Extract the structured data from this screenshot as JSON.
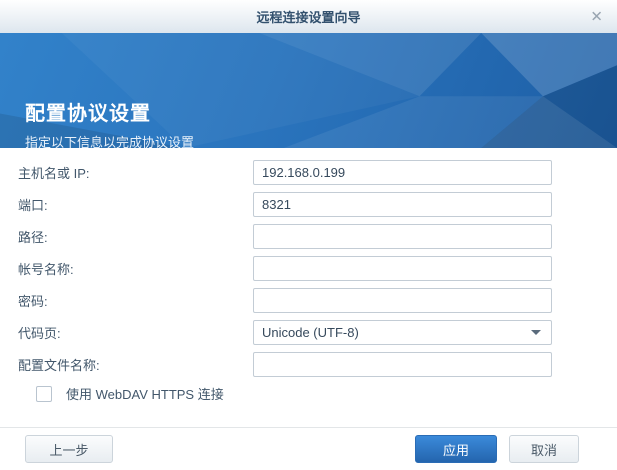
{
  "dialog": {
    "title": "远程连接设置向导"
  },
  "banner": {
    "title": "配置协议设置",
    "subtitle": "指定以下信息以完成协议设置"
  },
  "form": {
    "fields": [
      {
        "label": "主机名或 IP:",
        "value": "192.168.0.199",
        "type": "text"
      },
      {
        "label": "端口:",
        "value": "8321",
        "type": "text"
      },
      {
        "label": "路径:",
        "value": "",
        "type": "text"
      },
      {
        "label": "帐号名称:",
        "value": "",
        "type": "text"
      },
      {
        "label": "密码:",
        "value": "",
        "type": "password"
      },
      {
        "label": "代码页:",
        "value": "Unicode (UTF-8)",
        "type": "select"
      },
      {
        "label": "配置文件名称:",
        "value": "",
        "type": "text"
      }
    ],
    "checkbox": {
      "label": "使用 WebDAV HTTPS 连接",
      "checked": false
    }
  },
  "footer": {
    "back_label": "上一步",
    "apply_label": "应用",
    "cancel_label": "取消"
  },
  "icons": {
    "close": "✕"
  },
  "colors": {
    "accent": "#2a74bd",
    "primary_button": "#2f7ac9",
    "title_text": "#33516e"
  }
}
